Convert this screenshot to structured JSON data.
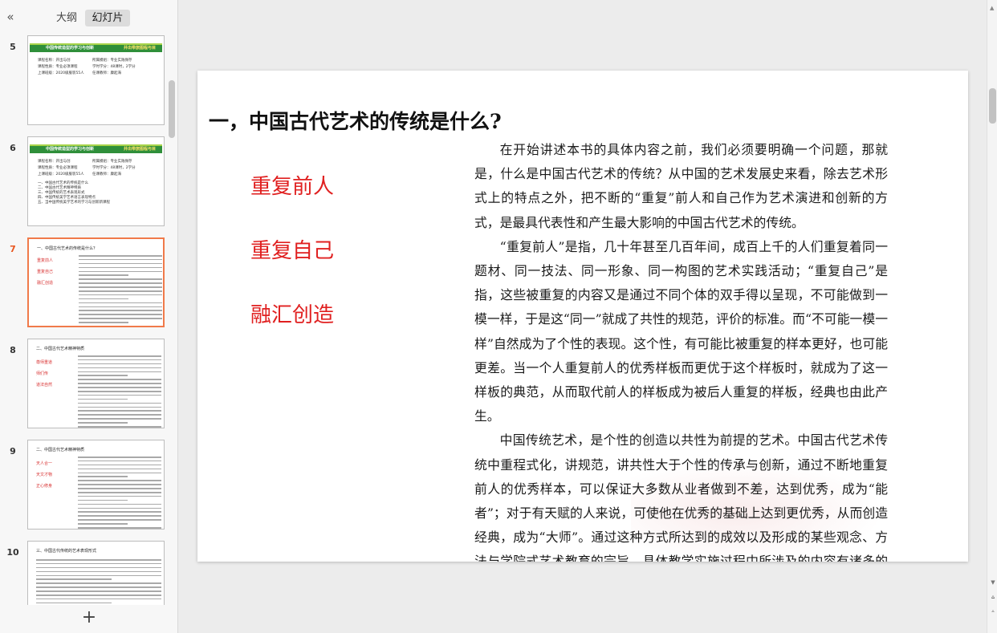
{
  "panel": {
    "collapse_icon": "«",
    "tab_outline": "大纲",
    "tab_slides": "幻灯片",
    "add_icon": "+"
  },
  "thumbnails": [
    {
      "num": "5",
      "kind": "cover",
      "bar_left": "中国传统造型的学习与创新",
      "bar_right": "并出带旅图程与目",
      "info": [
        [
          "课程名称：开出与创",
          "所属模组：专业实践保存"
        ],
        [
          "课程性质：专业必须课程",
          "学时学分：48课时，2学分"
        ],
        [
          "上课班级：2020级服装55人",
          "任课教师：康起海"
        ]
      ],
      "list": []
    },
    {
      "num": "6",
      "kind": "cover",
      "bar_left": "中国传统造型的学习与创新",
      "bar_right": "并出带旅图程与目",
      "info": [
        [
          "课程名称：开出与创",
          "所属模组：专业实践保存"
        ],
        [
          "课程性质：专业必须课程",
          "学时学分：48课时，2学分"
        ],
        [
          "上课班级：2020级服装55人",
          "任课教师：康起海"
        ]
      ],
      "list": [
        "一、中国古代艺术的传统是什么",
        "二、中国古代艺术精神特质",
        "三、中国传统的艺术表现形式",
        "四、中国传统美学艺术语言表现特点",
        "五、当中国传统美学艺术的学习与创新新课程"
      ]
    },
    {
      "num": "7",
      "kind": "content",
      "active": true,
      "title": "一、中国古代艺术的传统是什么？",
      "reds": [
        "重复前人",
        "重复自己",
        "融汇创造"
      ]
    },
    {
      "num": "8",
      "kind": "content",
      "title": "二、中国古代艺术精神特质",
      "reds": [
        "尊师重道",
        "师们传",
        "道法自然"
      ]
    },
    {
      "num": "9",
      "kind": "content",
      "title": "二、中国古代艺术精神特质",
      "reds": [
        "天人合一",
        "天文才物",
        "正心修身"
      ]
    },
    {
      "num": "10",
      "kind": "text",
      "title": "三、中国古代传统的艺术表现形式",
      "reds": []
    }
  ],
  "slide": {
    "title": "一，中国古代艺术的传统是什么?",
    "keywords": [
      "重复前人",
      "重复自己",
      "融汇创造"
    ],
    "paragraphs": [
      "在开始讲述本书的具体内容之前，我们必须要明确一个问题，那就是，什么是中国古代艺术的传统？从中国的艺术发展史来看，除去艺术形式上的特点之外，把不断的“重复”前人和自己作为艺术演进和创新的方式，是最具代表性和产生最大影响的中国古代艺术的传统。",
      "“重复前人”是指，几十年甚至几百年间，成百上千的人们重复着同一题材、同一技法、同一形象、同一构图的艺术实践活动；“重复自己”是指，这些被重复的内容又是通过不同个体的双手得以呈现，不可能做到一模一样，于是这“同一”就成了共性的规范，评价的标准。而“不可能一模一样”自然成为了个性的表现。这个性，有可能比被重复的样本更好，也可能更差。当一个人重复前人的优秀样板而更优于这个样板时，就成为了这一样板的典范，从而取代前人的样板成为被后人重复的样板，经典也由此产生。",
      "中国传统艺术，是个性的创造以共性为前提的艺术。中国古代艺术传统中重程式化，讲规范，讲共性大于个性的传承与创新，通过不断地重复前人的优秀样本，可以保证大多数从业者做到不差，达到优秀，成为“能者”；对于有天赋的人来说，可使他在优秀的基础上达到更优秀，从而创造经典，成为“大师”。通过这种方式所达到的成效以及形成的某些观念、方法与学院式艺术教育的宗旨、具体教学实施过程中所涉及的内容有诸多的相关和相同之处。所"
    ]
  },
  "scrollbar": {
    "up": "▲",
    "down": "▼",
    "prev": "⩠",
    "next": "⩡"
  }
}
